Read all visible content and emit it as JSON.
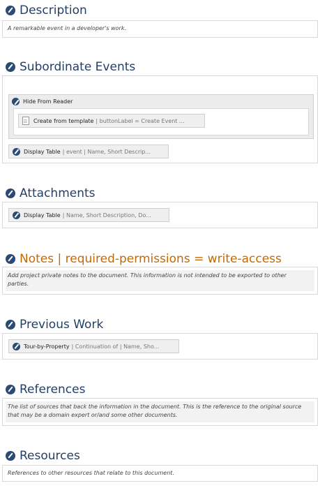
{
  "sections": {
    "description": {
      "title": "Description",
      "text": "A remarkable event in a developer's work."
    },
    "subordinate_events": {
      "title": "Subordinate Events",
      "group_label": "Hide From Reader",
      "template_button": {
        "label": "Create from template",
        "meta": "| buttonLabel = Create Event ..."
      },
      "display_table": {
        "label": "Display Table",
        "meta": "| event | Name, Short Descrip..."
      }
    },
    "attachments": {
      "title": "Attachments",
      "display_table": {
        "label": "Display Table",
        "meta": "| Name, Short Description, Do..."
      }
    },
    "notes": {
      "title": "Notes | required-permissions = write-access",
      "text": "Add project private notes to the document. This information is not intended to be exported to other parties."
    },
    "previous_work": {
      "title": "Previous Work",
      "tour": {
        "label": "Tour-by-Property",
        "meta": "| Continuation of | Name, Sho..."
      }
    },
    "references": {
      "title": "References",
      "text": "The list of sources that back the information in the document. This is the reference to the original source that may be a domain expert or/and some other documents."
    },
    "resources": {
      "title": "Resources",
      "text": "References to other resources that relate to this document."
    }
  },
  "colors": {
    "heading": "#243f66",
    "warning_heading": "#c46a00",
    "icon": "#2b4a74"
  }
}
